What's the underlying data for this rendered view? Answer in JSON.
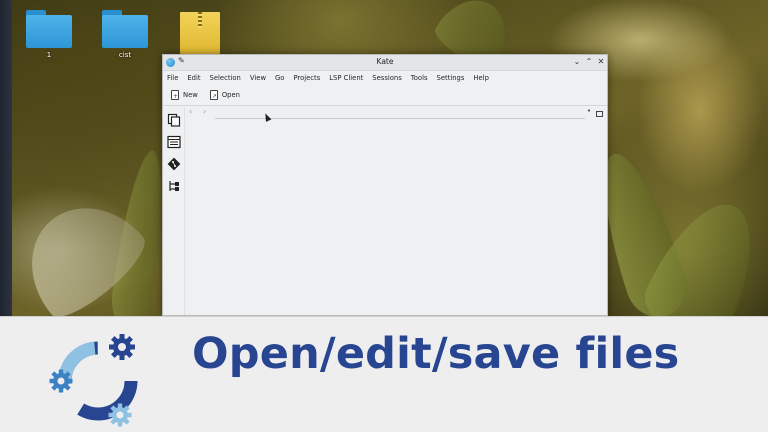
{
  "desktop": {
    "icons": [
      {
        "label": "1",
        "type": "folder"
      },
      {
        "label": "cist",
        "type": "folder"
      },
      {
        "label": "",
        "type": "archive"
      }
    ]
  },
  "window": {
    "title": "Kate",
    "controls": {
      "minimize": "⌄",
      "maximize": "⌃",
      "close": "✕"
    },
    "menu": [
      "File",
      "Edit",
      "Selection",
      "View",
      "Go",
      "Projects",
      "LSP Client",
      "Sessions",
      "Tools",
      "Settings",
      "Help"
    ],
    "toolbar": {
      "new_label": "New",
      "open_label": "Open"
    },
    "nav": {
      "back": "‹",
      "forward": "›"
    }
  },
  "banner": {
    "title": "Open/edit/save files"
  },
  "colors": {
    "accent": "#284592",
    "folder": "#3aa3e0",
    "archive": "#e8c540"
  }
}
